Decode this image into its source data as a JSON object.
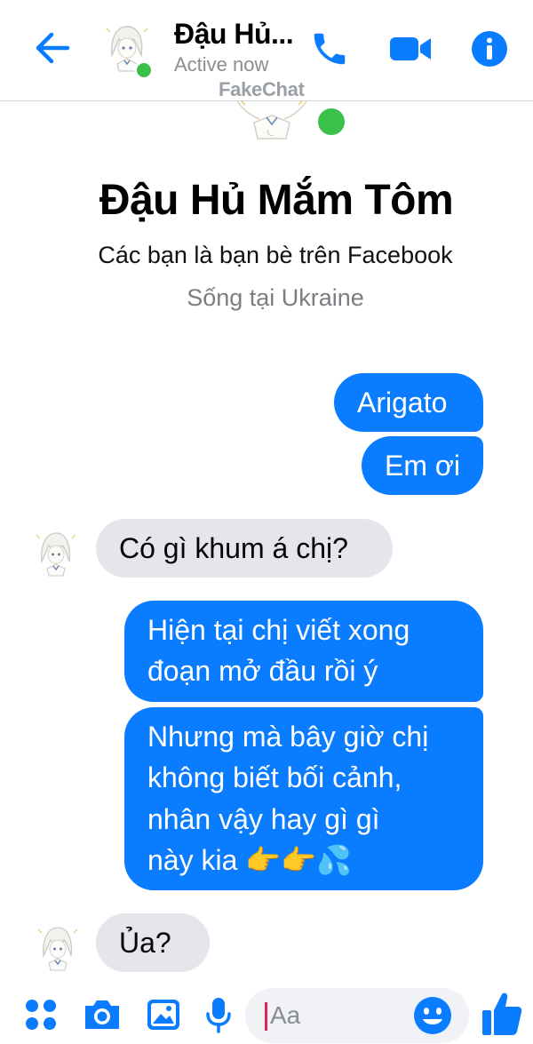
{
  "colors": {
    "accent": "#0a7cff",
    "online": "#3cc04c",
    "received_bubble": "#e4e6eb"
  },
  "header": {
    "contact_name": "Đậu Hủ...",
    "status": "Active now",
    "watermark": "FakeChat",
    "icons": [
      "back-arrow-icon",
      "phone-icon",
      "video-camera-icon",
      "info-icon"
    ]
  },
  "profile": {
    "name": "Đậu Hủ Mắm Tôm",
    "friendship": "Các bạn là bạn bè trên Facebook",
    "location": "Sống tại Ukraine"
  },
  "messages": [
    {
      "from": "me",
      "text": "Arigato"
    },
    {
      "from": "me",
      "text": "Em ơi"
    },
    {
      "from": "them",
      "text": "Có gì khum á chị?"
    },
    {
      "from": "me",
      "text": "Hiện tại chị viết xong\nđoạn mở đầu rồi ý"
    },
    {
      "from": "me",
      "text": "Nhưng mà bây giờ chị\nkhông biết bối cảnh,\nnhân vậy hay gì gì\nnày kia ",
      "emoji": [
        "👉",
        "👉",
        "💦"
      ]
    },
    {
      "from": "them",
      "text": "Ủa?"
    }
  ],
  "composer": {
    "placeholder": "Aa",
    "icons": [
      "apps-grid-icon",
      "camera-icon",
      "gallery-icon",
      "microphone-icon",
      "emoji-icon",
      "thumbs-up-icon"
    ]
  }
}
